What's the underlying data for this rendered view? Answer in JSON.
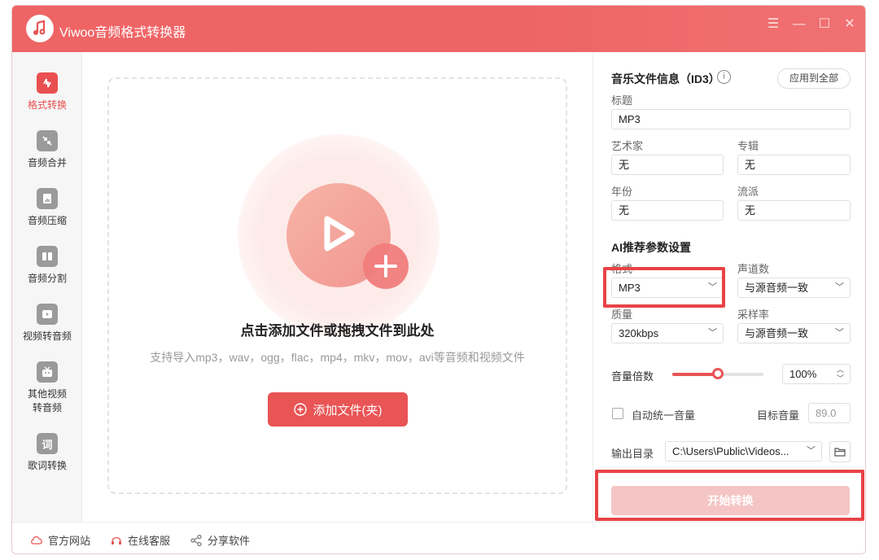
{
  "app": {
    "title": "Viwoo音频格式转换器"
  },
  "window_controls": {
    "menu": "☰",
    "minimize": "—",
    "maximize": "☐",
    "close": "✕"
  },
  "sidebar": {
    "items": [
      {
        "label": "格式转换",
        "icon": "convert-icon"
      },
      {
        "label": "音频合并",
        "icon": "merge-icon"
      },
      {
        "label": "音频压缩",
        "icon": "compress-icon"
      },
      {
        "label": "音频分割",
        "icon": "split-icon"
      },
      {
        "label": "视频转音频",
        "icon": "video-to-audio-icon"
      },
      {
        "label": "其他视频",
        "label2": "转音频",
        "icon": "tv-icon"
      },
      {
        "label": "歌词转换",
        "icon": "lyrics-icon",
        "glyph": "词"
      }
    ]
  },
  "dropzone": {
    "title": "点击添加文件或拖拽文件到此处",
    "subtitle": "支持导入mp3，wav，ogg，flac，mp4，mkv，mov，avi等音频和视频文件",
    "add_button": "添加文件(夹)"
  },
  "id3": {
    "section_title": "音乐文件信息（ID3）",
    "info_glyph": "i",
    "apply_all": "应用到全部",
    "title_label": "标题",
    "title_value": "MP3",
    "artist_label": "艺术家",
    "artist_value": "无",
    "album_label": "专辑",
    "album_value": "无",
    "year_label": "年份",
    "year_value": "无",
    "genre_label": "流派",
    "genre_value": "无"
  },
  "ai": {
    "section_title": "AI推荐参数设置",
    "format_label": "格式",
    "format_value": "MP3",
    "channels_label": "声道数",
    "channels_value": "与源音频一致",
    "quality_label": "质量",
    "quality_value": "320kbps",
    "samplerate_label": "采样率",
    "samplerate_value": "与源音频一致",
    "volume_label": "音量倍数",
    "volume_value": "100%",
    "volume_level": 0.5,
    "auto_volume_label": "自动统一音量",
    "target_volume_label": "目标音量",
    "target_volume_value": "89.0",
    "output_label": "输出目录",
    "output_value": "C:\\Users\\Public\\Videos..."
  },
  "start_button": "开始转换",
  "footer": {
    "website": "官方网站",
    "support": "在线客服",
    "share": "分享软件"
  },
  "colors": {
    "accent": "#e95455",
    "titlebar": "#ee6566",
    "highlight": "#e84347"
  }
}
